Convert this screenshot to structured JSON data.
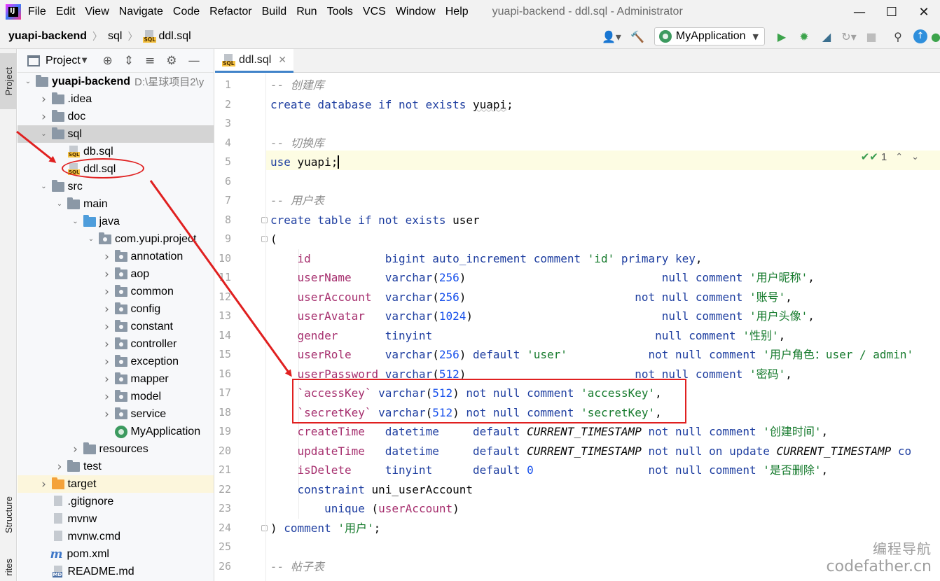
{
  "menu": {
    "items": [
      "File",
      "Edit",
      "View",
      "Navigate",
      "Code",
      "Refactor",
      "Build",
      "Run",
      "Tools",
      "VCS",
      "Window",
      "Help"
    ],
    "window_title": "yuapi-backend - ddl.sql - Administrator"
  },
  "breadcrumb": {
    "project": "yuapi-backend",
    "folder": "sql",
    "file": "ddl.sql"
  },
  "toolbar": {
    "run_config": "MyApplication"
  },
  "side_tabs": {
    "project": "Project",
    "structure": "Structure",
    "favorites": "rites"
  },
  "project_panel": {
    "title": "Project",
    "tree": [
      {
        "label": "yuapi-backend",
        "path": "D:\\星球项目2\\y",
        "depth": 0,
        "arrow": "down",
        "icon": "module-folder"
      },
      {
        "label": ".idea",
        "depth": 1,
        "arrow": "right",
        "icon": "folder"
      },
      {
        "label": "doc",
        "depth": 1,
        "arrow": "right",
        "icon": "folder"
      },
      {
        "label": "sql",
        "depth": 1,
        "arrow": "down",
        "icon": "folder",
        "selected": true
      },
      {
        "label": "db.sql",
        "depth": 2,
        "arrow": "",
        "icon": "sql-file"
      },
      {
        "label": "ddl.sql",
        "depth": 2,
        "arrow": "",
        "icon": "sql-file"
      },
      {
        "label": "src",
        "depth": 1,
        "arrow": "down",
        "icon": "folder"
      },
      {
        "label": "main",
        "depth": 2,
        "arrow": "down",
        "icon": "folder"
      },
      {
        "label": "java",
        "depth": 3,
        "arrow": "down",
        "icon": "source-folder"
      },
      {
        "label": "com.yupi.project",
        "depth": 4,
        "arrow": "down",
        "icon": "package"
      },
      {
        "label": "annotation",
        "depth": 5,
        "arrow": "right",
        "icon": "package"
      },
      {
        "label": "aop",
        "depth": 5,
        "arrow": "right",
        "icon": "package"
      },
      {
        "label": "common",
        "depth": 5,
        "arrow": "right",
        "icon": "package"
      },
      {
        "label": "config",
        "depth": 5,
        "arrow": "right",
        "icon": "package"
      },
      {
        "label": "constant",
        "depth": 5,
        "arrow": "right",
        "icon": "package"
      },
      {
        "label": "controller",
        "depth": 5,
        "arrow": "right",
        "icon": "package"
      },
      {
        "label": "exception",
        "depth": 5,
        "arrow": "right",
        "icon": "package"
      },
      {
        "label": "mapper",
        "depth": 5,
        "arrow": "right",
        "icon": "package"
      },
      {
        "label": "model",
        "depth": 5,
        "arrow": "right",
        "icon": "package"
      },
      {
        "label": "service",
        "depth": 5,
        "arrow": "right",
        "icon": "package"
      },
      {
        "label": "MyApplication",
        "depth": 5,
        "arrow": "",
        "icon": "spring-class"
      },
      {
        "label": "resources",
        "depth": 3,
        "arrow": "right",
        "icon": "resources-folder"
      },
      {
        "label": "test",
        "depth": 2,
        "arrow": "right",
        "icon": "folder"
      },
      {
        "label": "target",
        "depth": 1,
        "arrow": "right",
        "icon": "excluded-folder",
        "highlight": true
      },
      {
        "label": ".gitignore",
        "depth": 1,
        "arrow": "",
        "icon": "text-file"
      },
      {
        "label": "mvnw",
        "depth": 1,
        "arrow": "",
        "icon": "mvn-file"
      },
      {
        "label": "mvnw.cmd",
        "depth": 1,
        "arrow": "",
        "icon": "mvn-file"
      },
      {
        "label": "pom.xml",
        "depth": 1,
        "arrow": "",
        "icon": "maven-icon"
      },
      {
        "label": "README.md",
        "depth": 1,
        "arrow": "",
        "icon": "md-file"
      }
    ]
  },
  "editor": {
    "tab_label": "ddl.sql",
    "inspection_count": "1",
    "line_numbers": [
      "1",
      "2",
      "3",
      "4",
      "5",
      "6",
      "7",
      "8",
      "9",
      "10",
      "11",
      "12",
      "13",
      "14",
      "15",
      "16",
      "17",
      "18",
      "19",
      "20",
      "21",
      "22",
      "23",
      "24",
      "25",
      "26"
    ],
    "lines": [
      [
        [
          "cm",
          "-- 创建库"
        ]
      ],
      [
        [
          "kw",
          "create database if not exists "
        ],
        [
          "sq",
          "yuapi"
        ],
        [
          "",
          "; "
        ]
      ],
      [],
      [
        [
          "cm",
          "-- 切换库"
        ]
      ],
      [
        [
          "kw",
          "use "
        ],
        [
          "",
          "yuapi;"
        ]
      ],
      [],
      [
        [
          "cm",
          "-- 用户表"
        ]
      ],
      [
        [
          "kw",
          "create table if not exists "
        ],
        [
          "",
          "user"
        ]
      ],
      [
        [
          "",
          "("
        ]
      ],
      [
        [
          "",
          "    "
        ],
        [
          "col",
          "id"
        ],
        [
          "",
          "           "
        ],
        [
          "kw",
          "bigint auto_increment comment "
        ],
        [
          "str",
          "'id'"
        ],
        [
          "kw",
          " primary key"
        ],
        [
          "",
          ","
        ]
      ],
      [
        [
          "",
          "    "
        ],
        [
          "col",
          "userName"
        ],
        [
          "",
          "     "
        ],
        [
          "kw",
          "varchar"
        ],
        [
          "",
          "("
        ],
        [
          "num",
          "256"
        ],
        [
          ")",
          ")"
        ],
        [
          "",
          "                             "
        ],
        [
          "kw",
          "null comment "
        ],
        [
          "str",
          "'用户昵称'"
        ],
        [
          "",
          ","
        ]
      ],
      [
        [
          "",
          "    "
        ],
        [
          "col",
          "userAccount"
        ],
        [
          "",
          "  "
        ],
        [
          "kw",
          "varchar"
        ],
        [
          "",
          "("
        ],
        [
          "num",
          "256"
        ],
        [
          "",
          ")"
        ],
        [
          "",
          "                         "
        ],
        [
          "kw",
          "not null comment "
        ],
        [
          "str",
          "'账号'"
        ],
        [
          "",
          ","
        ]
      ],
      [
        [
          "",
          "    "
        ],
        [
          "col",
          "userAvatar"
        ],
        [
          "",
          "   "
        ],
        [
          "kw",
          "varchar"
        ],
        [
          "",
          "("
        ],
        [
          "num",
          "1024"
        ],
        [
          "",
          ")"
        ],
        [
          "",
          "                            "
        ],
        [
          "kw",
          "null comment "
        ],
        [
          "str",
          "'用户头像'"
        ],
        [
          "",
          ","
        ]
      ],
      [
        [
          "",
          "    "
        ],
        [
          "col",
          "gender"
        ],
        [
          "",
          "       "
        ],
        [
          "kw",
          "tinyint"
        ],
        [
          "",
          "                                 "
        ],
        [
          "kw",
          "null comment "
        ],
        [
          "str",
          "'性别'"
        ],
        [
          "",
          ","
        ]
      ],
      [
        [
          "",
          "    "
        ],
        [
          "col",
          "userRole"
        ],
        [
          "",
          "     "
        ],
        [
          "kw",
          "varchar"
        ],
        [
          "",
          "("
        ],
        [
          "num",
          "256"
        ],
        [
          "",
          ") "
        ],
        [
          "kw",
          "default "
        ],
        [
          "str",
          "'user'"
        ],
        [
          "",
          "            "
        ],
        [
          "kw",
          "not null comment "
        ],
        [
          "str",
          "'用户角色：user / admin'"
        ]
      ],
      [
        [
          "",
          "    "
        ],
        [
          "col",
          "userPassword"
        ],
        [
          "",
          " "
        ],
        [
          "kw",
          "varchar"
        ],
        [
          "",
          "("
        ],
        [
          "num",
          "512"
        ],
        [
          "",
          ")"
        ],
        [
          "",
          "                         "
        ],
        [
          "kw",
          "not null comment "
        ],
        [
          "str",
          "'密码'"
        ],
        [
          "",
          ","
        ]
      ],
      [
        [
          "",
          "    "
        ],
        [
          "col",
          "`accessKey`"
        ],
        [
          "",
          " "
        ],
        [
          "kw",
          "varchar"
        ],
        [
          "",
          "("
        ],
        [
          "num",
          "512"
        ],
        [
          "",
          ") "
        ],
        [
          "kw",
          "not null comment "
        ],
        [
          "str",
          "'accessKey'"
        ],
        [
          "",
          ","
        ]
      ],
      [
        [
          "",
          "    "
        ],
        [
          "col",
          "`secretKey`"
        ],
        [
          "",
          " "
        ],
        [
          "kw",
          "varchar"
        ],
        [
          "",
          "("
        ],
        [
          "num",
          "512"
        ],
        [
          "",
          ") "
        ],
        [
          "kw",
          "not null comment "
        ],
        [
          "str",
          "'secretKey'"
        ],
        [
          "",
          ","
        ]
      ],
      [
        [
          "",
          "    "
        ],
        [
          "col",
          "createTime"
        ],
        [
          "",
          "   "
        ],
        [
          "kw",
          "datetime"
        ],
        [
          "",
          "     "
        ],
        [
          "kw",
          "default "
        ],
        [
          "fn",
          "CURRENT_TIMESTAMP"
        ],
        [
          "",
          " "
        ],
        [
          "kw",
          "not null comment "
        ],
        [
          "str",
          "'创建时间'"
        ],
        [
          "",
          ","
        ]
      ],
      [
        [
          "",
          "    "
        ],
        [
          "col",
          "updateTime"
        ],
        [
          "",
          "   "
        ],
        [
          "kw",
          "datetime"
        ],
        [
          "",
          "     "
        ],
        [
          "kw",
          "default "
        ],
        [
          "fn",
          "CURRENT_TIMESTAMP"
        ],
        [
          "",
          " "
        ],
        [
          "kw",
          "not null on update "
        ],
        [
          "fn",
          "CURRENT_TIMESTAMP"
        ],
        [
          "",
          " "
        ],
        [
          "kw",
          "co"
        ]
      ],
      [
        [
          "",
          "    "
        ],
        [
          "col",
          "isDelete"
        ],
        [
          "",
          "     "
        ],
        [
          "kw",
          "tinyint"
        ],
        [
          "",
          "      "
        ],
        [
          "kw",
          "default "
        ],
        [
          "num",
          "0"
        ],
        [
          "",
          "                 "
        ],
        [
          "kw",
          "not null comment "
        ],
        [
          "str",
          "'是否删除'"
        ],
        [
          "",
          ","
        ]
      ],
      [
        [
          "",
          "    "
        ],
        [
          "kw",
          "constraint "
        ],
        [
          "",
          "uni_userAccount"
        ]
      ],
      [
        [
          "",
          "        "
        ],
        [
          "kw",
          "unique "
        ],
        [
          "",
          "("
        ],
        [
          "col",
          "userAccount"
        ],
        [
          "",
          ")"
        ]
      ],
      [
        [
          "",
          ") "
        ],
        [
          "kw",
          "comment "
        ],
        [
          "str",
          "'用户'"
        ],
        [
          "",
          ";"
        ]
      ],
      [],
      [
        [
          "cm",
          "-- 帖子表"
        ]
      ]
    ]
  },
  "watermark": {
    "line1": "编程导航",
    "line2": "codefather.cn"
  },
  "colors": {
    "annotation_red": "#e02020",
    "keyword_blue": "#1e3ea0",
    "string_green": "#157a2c",
    "column_purple": "#a62f6e"
  }
}
